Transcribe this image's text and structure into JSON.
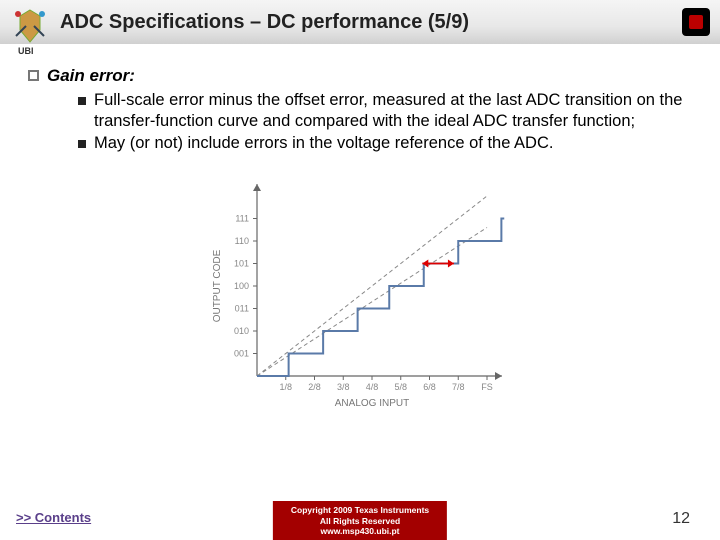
{
  "header": {
    "title": "ADC Specifications – DC performance (5/9)",
    "ubi_label": "UBI"
  },
  "body": {
    "section_label": "Gain error:",
    "sub_items": [
      "Full-scale error minus the offset error, measured at the last ADC transition on the transfer-function curve and compared with the ideal ADC transfer function;",
      "May (or not) include errors in the voltage reference of the ADC."
    ]
  },
  "chart_data": {
    "type": "line",
    "title": "",
    "xlabel": "ANALOG INPUT",
    "ylabel": "OUTPUT CODE",
    "x_ticks": [
      "1/8",
      "2/8",
      "3/8",
      "4/8",
      "5/8",
      "6/8",
      "7/8",
      "FS"
    ],
    "y_ticks": [
      "001",
      "010",
      "011",
      "100",
      "101",
      "110",
      "111"
    ],
    "series": [
      {
        "name": "ideal",
        "style": "dashed",
        "color": "#666",
        "points": [
          [
            0,
            0
          ],
          [
            8,
            8
          ]
        ]
      },
      {
        "name": "actual-gain",
        "style": "dashed",
        "color": "#666",
        "points": [
          [
            0,
            0
          ],
          [
            8,
            6.6
          ]
        ]
      },
      {
        "name": "actual-stair",
        "style": "solid",
        "color": "#5a7aa8",
        "steps": [
          [
            0,
            0
          ],
          [
            1.1,
            1
          ],
          [
            2.3,
            2
          ],
          [
            3.5,
            3
          ],
          [
            4.6,
            4
          ],
          [
            5.8,
            5
          ],
          [
            7,
            6
          ],
          [
            8.5,
            7
          ]
        ]
      }
    ],
    "annotations": [
      {
        "name": "gain-error-arrow",
        "color": "#d00",
        "x": 6.3,
        "y": 5,
        "type": "double-arrow-h"
      }
    ]
  },
  "footer": {
    "contents_link": ">> Contents",
    "copyright_line1": "Copyright  2009 Texas Instruments",
    "copyright_line2": "All Rights Reserved",
    "site": "www.msp430.ubi.pt",
    "page_number": "12"
  }
}
